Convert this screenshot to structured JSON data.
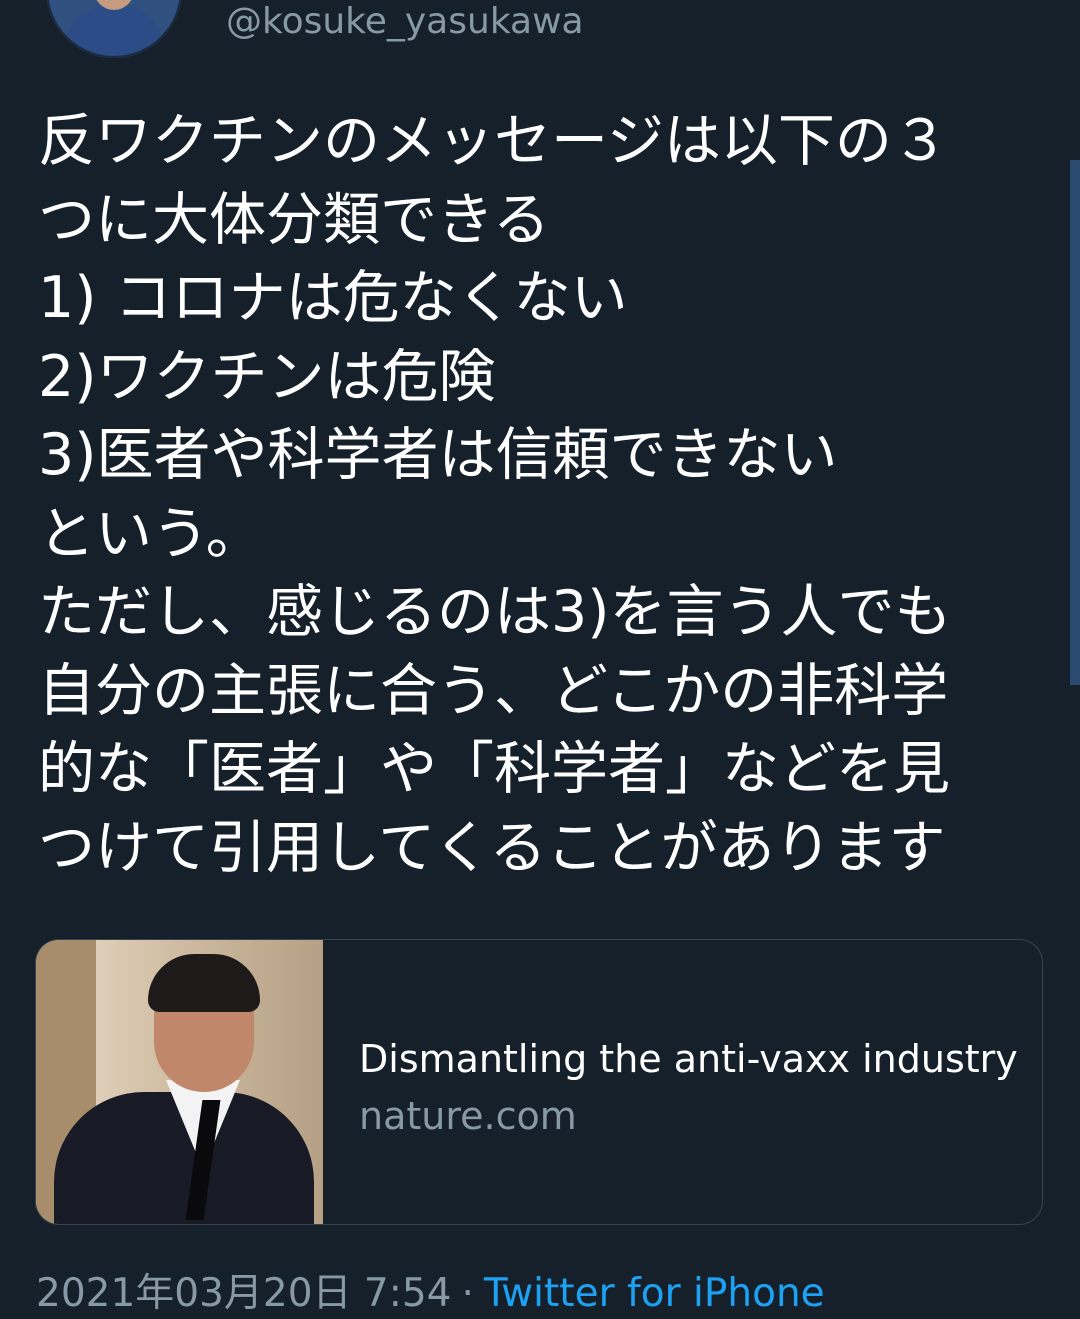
{
  "tweet": {
    "handle": "@kosuke_yasukawa",
    "lines": [
      "反ワクチンのメッセージは以下の３",
      "つに大体分類できる",
      "1) コロナは危なくない",
      "2)ワクチンは危険",
      "3)医者や科学者は信頼できない",
      "という。",
      "ただし、感じるのは3)を言う人でも",
      "自分の主張に合う、どこかの非科学",
      "的な「医者」や「科学者」などを見",
      "つけて引用してくることがあります"
    ],
    "link_card": {
      "title": "Dismantling the anti-vaxx industry",
      "domain": "nature.com"
    },
    "timestamp": "2021年03月20日 7:54",
    "separator": "·",
    "client": "Twitter for iPhone"
  },
  "colors": {
    "background": "#15202b",
    "text": "#ffffff",
    "secondary_text": "#8899a6",
    "link": "#1da1f2",
    "card_border": "#38444d"
  }
}
